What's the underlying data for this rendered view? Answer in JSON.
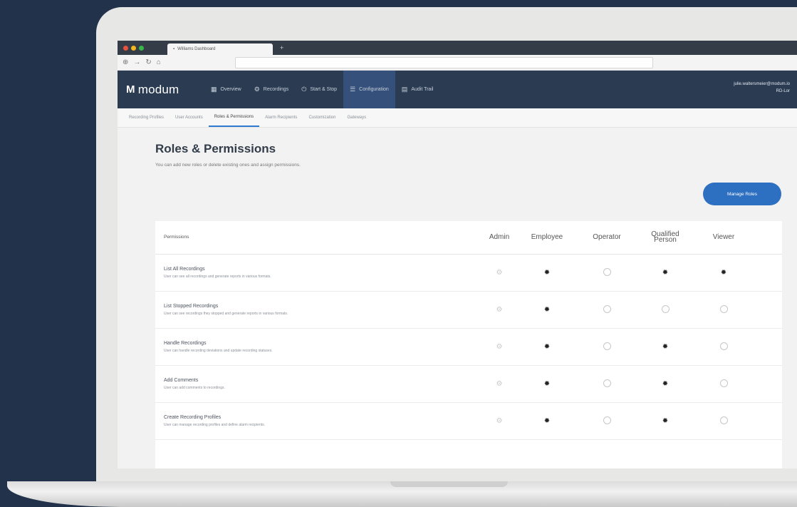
{
  "browser": {
    "tab_title": "Williams Dashboard",
    "traffic_colors": [
      "#e5533d",
      "#f2b61e",
      "#3ab54a"
    ],
    "nav_icons": [
      "back-icon",
      "forward-icon",
      "reload-icon",
      "home-icon"
    ]
  },
  "app": {
    "logo": "modum",
    "nav": [
      {
        "label": "Overview",
        "icon": "grid-icon"
      },
      {
        "label": "Recordings",
        "icon": "settings-icon"
      },
      {
        "label": "Start & Stop",
        "icon": "power-icon"
      },
      {
        "label": "Configuration",
        "icon": "config-icon",
        "active": true
      },
      {
        "label": "Audit Trail",
        "icon": "document-icon"
      }
    ],
    "user_email": "julie.waltersmeier@modum.io",
    "user_role": "RD-Lor"
  },
  "subtabs": [
    "Recording Profiles",
    "User Accounts",
    "Roles & Permissions",
    "Alarm Recipients",
    "Customization",
    "Gateways"
  ],
  "page": {
    "title": "Roles & Permissions",
    "description": "You can add new roles or delete existing ones and assign permissions.",
    "manage_button": "Manage Roles"
  },
  "table": {
    "headers": [
      "Permissions",
      "Admin",
      "Employee",
      "Operator",
      "Qualified Person",
      "Viewer"
    ],
    "rows": [
      {
        "title": "List All Recordings",
        "desc": "User can see all recordings and generate reports in various formats.",
        "values": [
          "locked",
          "on",
          "off",
          "on",
          "on"
        ]
      },
      {
        "title": "List Stopped Recordings",
        "desc": "User can see recordings they stopped and generate reports in various formats.",
        "values": [
          "locked",
          "on",
          "off",
          "off",
          "off"
        ]
      },
      {
        "title": "Handle Recordings",
        "desc": "User can handle recording deviations and update recording statuses.",
        "values": [
          "locked",
          "on",
          "off",
          "on",
          "off"
        ]
      },
      {
        "title": "Add Comments",
        "desc": "User can add comments to recordings.",
        "values": [
          "locked",
          "on",
          "off",
          "on",
          "off"
        ]
      },
      {
        "title": "Create Recording Profiles",
        "desc": "User can manage recording profiles and define alarm recipients.",
        "values": [
          "locked",
          "on",
          "off",
          "on",
          "off"
        ]
      }
    ]
  },
  "colors": {
    "page_bg": "#22324a",
    "appbar": "#2a3b52",
    "active_nav": "#35507a",
    "primary_button": "#2d6fc0"
  }
}
